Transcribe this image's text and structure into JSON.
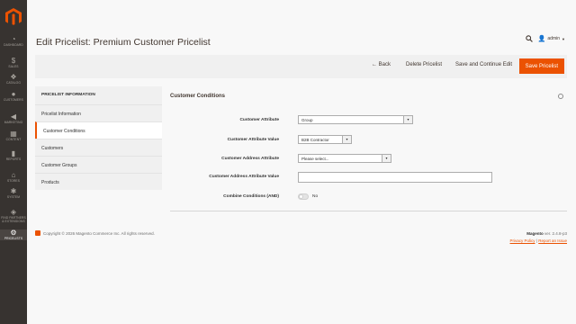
{
  "sidebar": {
    "items": [
      {
        "label": "Dashboard",
        "icon": "dashboard-icon",
        "glyph": "◔"
      },
      {
        "label": "Sales",
        "icon": "dollar-icon",
        "glyph": "$"
      },
      {
        "label": "Catalog",
        "icon": "cube-icon",
        "glyph": "❖"
      },
      {
        "label": "Customers",
        "icon": "person-icon",
        "glyph": "●"
      },
      {
        "label": "Marketing",
        "icon": "megaphone-icon",
        "glyph": "◀"
      },
      {
        "label": "Content",
        "icon": "content-icon",
        "glyph": "▦"
      },
      {
        "label": "Reports",
        "icon": "bar-chart-icon",
        "glyph": "▮"
      },
      {
        "label": "Stores",
        "icon": "store-icon",
        "glyph": "⌂"
      },
      {
        "label": "System",
        "icon": "gear-icon",
        "glyph": "✱"
      },
      {
        "label": "Find Partners & Extensions",
        "icon": "puzzle-icon",
        "glyph": "◈"
      },
      {
        "label": "Pricelists",
        "icon": "pricelist-icon",
        "glyph": "⚙"
      }
    ]
  },
  "header": {
    "title": "Edit Pricelist: Premium Customer Pricelist",
    "user": "admin"
  },
  "actions": {
    "back": "← Back",
    "delete": "Delete Pricelist",
    "save_continue": "Save and Continue Edit",
    "save": "Save Pricelist"
  },
  "tabs": {
    "header": "PRICELIST INFORMATION",
    "items": [
      "Pricelist Information",
      "Customer Conditions",
      "Customers",
      "Customer Groups",
      "Products"
    ]
  },
  "section": {
    "title": "Customer Conditions"
  },
  "form": {
    "customer_attribute": {
      "label": "Customer Attribute",
      "value": "Group"
    },
    "customer_attribute_value": {
      "label": "Customer Attribute Value",
      "value": "B2B Contractor"
    },
    "customer_address_attribute": {
      "label": "Customer Address Attribute",
      "value": "Please select..."
    },
    "customer_address_attribute_value": {
      "label": "Customer Address Attribute Value",
      "value": ""
    },
    "combine_conditions": {
      "label": "Combine Conditions (AND)",
      "value": "No"
    }
  },
  "footer": {
    "copyright": "Copyright © 2026 Magento Commerce Inc. All rights reserved.",
    "brand": "Magento",
    "version": " ver. 2.4.8-p3",
    "privacy": "Privacy Policy",
    "separator": " | ",
    "report": "Report an Issue"
  },
  "colors": {
    "accent": "#eb5202",
    "sidebar": "#373330"
  }
}
